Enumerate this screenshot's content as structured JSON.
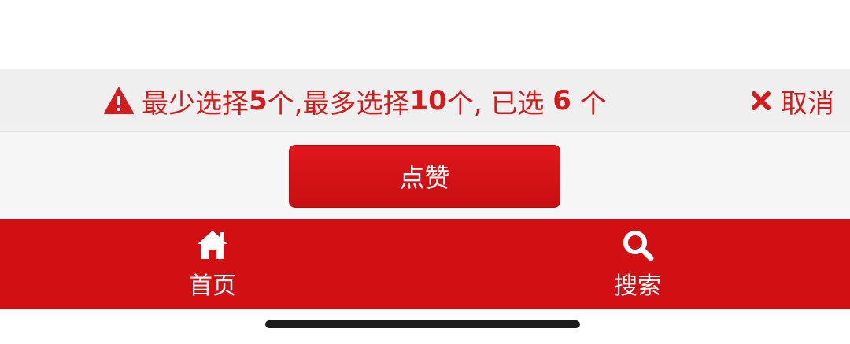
{
  "notice": {
    "prefix": "最少选择",
    "min_count": "5",
    "mid": "个,最多选择",
    "max_count": "10",
    "selected_label": "个, 已选 ",
    "selected_count": "6",
    "suffix": " 个",
    "icon": "warning-triangle-icon"
  },
  "cancel": {
    "label": "取消",
    "icon": "close-icon"
  },
  "like_button": {
    "label": "点赞"
  },
  "tabbar": {
    "home": {
      "label": "首页",
      "icon": "home-icon"
    },
    "search": {
      "label": "搜索",
      "icon": "search-icon"
    }
  },
  "colors": {
    "accent": "#d20f13",
    "notice_bg": "#efefef",
    "text_red": "#d41a1a"
  }
}
